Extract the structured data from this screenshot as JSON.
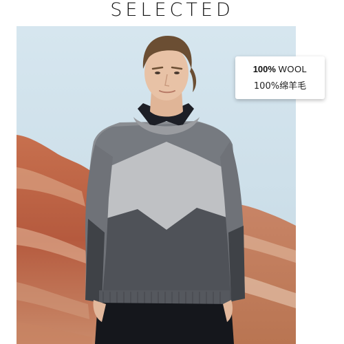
{
  "brand": {
    "name": "SELECTED"
  },
  "badge": {
    "percent": "100%",
    "material": "WOOL",
    "chinese": "100%绵羊毛"
  },
  "photo": {
    "sky_color": "#c9dde9",
    "rock_color": "#b8664a",
    "sweater_light": "#bfc1c4",
    "sweater_dark": "#55585e",
    "trousers": "#15171c"
  }
}
